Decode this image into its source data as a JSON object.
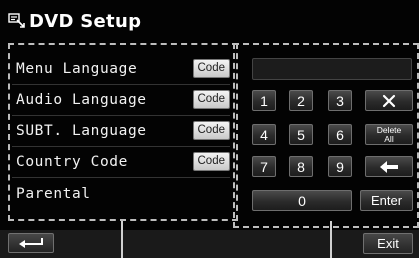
{
  "header": {
    "title": "DVD Setup",
    "icon": "settings-screen-icon"
  },
  "menu": {
    "items": [
      {
        "label": "Menu Language",
        "button": "Code"
      },
      {
        "label": "Audio Language",
        "button": "Code"
      },
      {
        "label": "SUBT. Language",
        "button": "Code"
      },
      {
        "label": "Country Code",
        "button": "Code"
      },
      {
        "label": "Parental",
        "button": ""
      }
    ]
  },
  "keypad": {
    "display_value": "",
    "keys": [
      "1",
      "2",
      "3",
      "4",
      "5",
      "6",
      "7",
      "8",
      "9",
      "0"
    ],
    "clear_icon": "close-icon",
    "delete_all_line1": "Delete",
    "delete_all_line2": "All",
    "backspace_icon": "arrow-left-icon",
    "enter_label": "Enter"
  },
  "footer": {
    "back_icon": "return-arrow-icon",
    "exit_label": "Exit"
  },
  "colors": {
    "background": "#030303",
    "frame": "#bdbdbd",
    "key_face": "#2b2b2b",
    "code_button": "#e0e0e0"
  }
}
